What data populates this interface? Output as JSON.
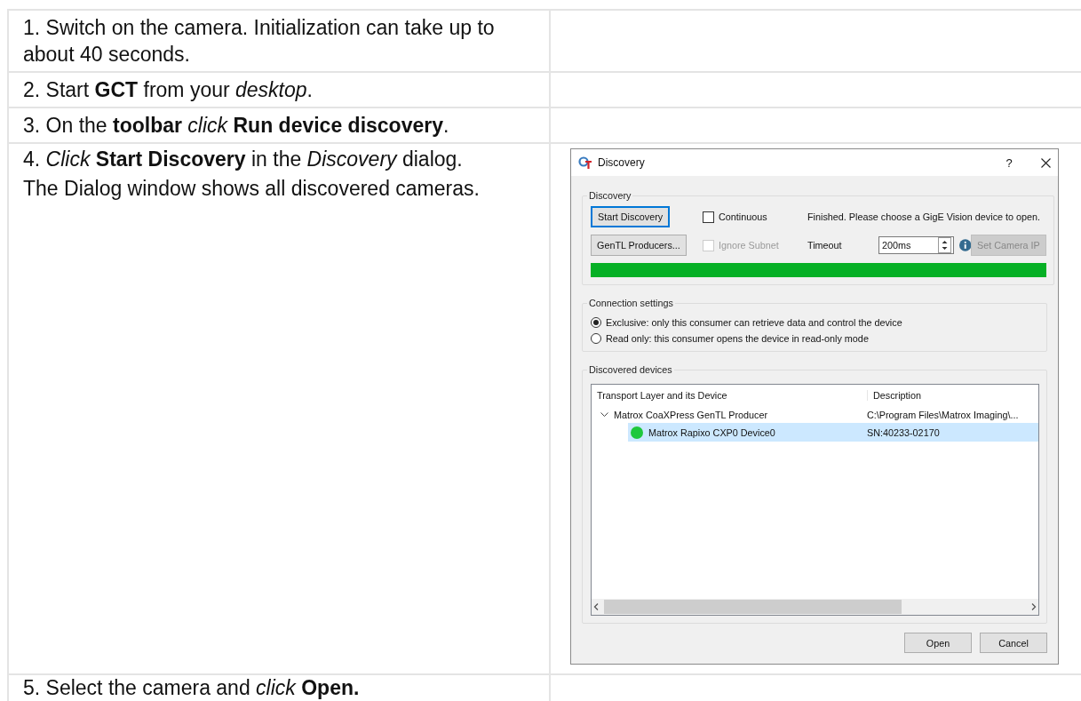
{
  "steps": [
    {
      "lines": [
        "1. Switch on the camera. Initialization can take up to about 40 seconds."
      ]
    },
    {
      "lines": [
        "2. Start **GCT**  from your *desktop*."
      ]
    },
    {
      "lines": [
        "3. On the **toolbar** *click* **Run device discovery**."
      ]
    },
    {
      "lines": [
        "4. *Click* **Start Discovery** in the *Discovery* dialog.",
        "The Dialog window shows all discovered cameras."
      ],
      "dialog": {
        "title": "Discovery",
        "help": "?",
        "discovery_group": {
          "title": "Discovery",
          "start_button": {
            "label": "Start Discovery",
            "focused": true
          },
          "continuous": {
            "label": "Continuous",
            "checked": false
          },
          "status": "Finished. Please choose a GigE Vision device to open.",
          "producers_button": {
            "label": "GenTL Producers..."
          },
          "ignore_subnet": {
            "label": "Ignore Subnet",
            "checked": false,
            "disabled": true
          },
          "timeout_label": "Timeout",
          "timeout": {
            "value": "200ms"
          },
          "set_ip_button": {
            "label": "Set Camera IP",
            "disabled": true
          },
          "progress": {
            "level": 1
          }
        },
        "connection_group": {
          "title": "Connection settings",
          "options": [
            {
              "label": "Exclusive: only this consumer can retrieve data and control the device",
              "selected": true
            },
            {
              "label": "Read only: this consumer opens the device in read-only mode",
              "selected": false
            }
          ]
        },
        "devices_group": {
          "title": "Discovered devices",
          "columns": [
            "Transport Layer and its Device",
            "Description"
          ],
          "rows": [
            {
              "name": "Matrox CoaXPress GenTL Producer",
              "description": "C:\\Program Files\\Matrox Imaging\\...",
              "expanded": true,
              "selected": false,
              "children": [
                {
                  "name": "Matrox Rapixo CXP0 Device0",
                  "description": "SN:40233-02170",
                  "color": "#1ec83c",
                  "selected": true
                }
              ]
            }
          ]
        },
        "buttons": [
          {
            "label": "Open"
          },
          {
            "label": "Cancel"
          }
        ]
      }
    },
    {
      "lines": [
        "5. Select the camera and *click* **Open.**"
      ]
    }
  ]
}
